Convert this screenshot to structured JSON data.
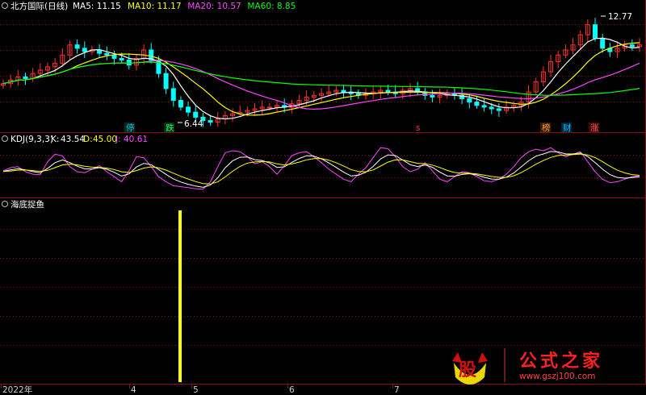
{
  "main_panel": {
    "title": "北方国际(日线)",
    "ma": [
      {
        "label": "MA5:",
        "value": "11.15",
        "color": "#ffffff"
      },
      {
        "label": "MA10:",
        "value": "11.17",
        "color": "#ffff00"
      },
      {
        "label": "MA20:",
        "value": "10.57",
        "color": "#ff44ff"
      },
      {
        "label": "MA60:",
        "value": "8.85",
        "color": "#00ff00"
      }
    ],
    "high_label": "12.77",
    "low_label": "6.44",
    "event_markers": [
      {
        "text": "停",
        "color": "#00c8c8",
        "bg": "#0a2a2a"
      },
      {
        "text": "跌",
        "color": "#00ff66",
        "bg": "#0a2a12"
      },
      {
        "text": "s",
        "color": "#ff3030",
        "bg": ""
      },
      {
        "text": "榜",
        "color": "#ff9933",
        "bg": "#3a2000"
      },
      {
        "text": "财",
        "color": "#00c8ff",
        "bg": "#00203a"
      },
      {
        "text": "涨",
        "color": "#ff5555",
        "bg": "#3a0a0a"
      }
    ]
  },
  "kdj_panel": {
    "title": "KDJ(9,3,3)",
    "k_label": "K:",
    "k_value": "43.54",
    "d_label": "D:",
    "d_value": "45.00",
    "j_label": "J:",
    "j_value": "40.61"
  },
  "signal_panel": {
    "title": "海底捉鱼"
  },
  "x_axis": {
    "labels": [
      "2022年",
      "4",
      "5",
      "6",
      "7"
    ]
  },
  "watermark": {
    "logo_char": "股",
    "brand": "公式之家",
    "url": "www.gszj100.com"
  },
  "colors": {
    "up_candle": "#ff3232",
    "down_candle": "#00ffff",
    "ma5": "#ffffff",
    "ma10": "#ffff00",
    "ma20": "#ff44ff",
    "ma60": "#00ff00",
    "kdj_k": "#ffffff",
    "kdj_d": "#ffff00",
    "kdj_j": "#ff44ff",
    "signal_bar": "#ffff00",
    "grid": "#8b1010"
  },
  "chart_data": [
    {
      "type": "candlestick",
      "title": "北方国际(日线)",
      "high_marker": 12.77,
      "low_marker": 6.44,
      "series": [
        {
          "name": "MA5",
          "last": 11.15
        },
        {
          "name": "MA10",
          "last": 11.17
        },
        {
          "name": "MA20",
          "last": 10.57
        },
        {
          "name": "MA60",
          "last": 8.85
        }
      ],
      "closes": [
        8.9,
        9.1,
        9.3,
        9.2,
        9.5,
        9.7,
        9.9,
        10.1,
        10.6,
        11.2,
        11.0,
        10.8,
        10.9,
        10.7,
        10.6,
        10.4,
        10.3,
        10.0,
        10.4,
        10.9,
        10.3,
        9.5,
        8.6,
        7.9,
        7.5,
        7.2,
        6.9,
        6.7,
        6.6,
        6.8,
        7.0,
        7.1,
        7.2,
        7.3,
        7.4,
        7.5,
        7.5,
        7.6,
        7.5,
        7.7,
        7.9,
        8.1,
        8.2,
        8.3,
        8.4,
        8.5,
        8.4,
        8.3,
        8.2,
        8.3,
        8.4,
        8.5,
        8.4,
        8.3,
        8.5,
        8.6,
        8.4,
        8.2,
        8.1,
        8.2,
        8.3,
        8.2,
        8.0,
        7.8,
        7.6,
        7.5,
        7.4,
        7.3,
        7.5,
        7.6,
        7.8,
        8.4,
        9.0,
        9.6,
        10.2,
        10.6,
        10.9,
        11.2,
        11.8,
        12.4,
        11.6,
        11.0,
        10.8,
        11.0,
        11.2,
        11.1,
        11.2
      ]
    },
    {
      "type": "line",
      "title": "KDJ(9,3,3)",
      "series": [
        {
          "name": "K",
          "last": 43.54
        },
        {
          "name": "D",
          "last": 45.0
        },
        {
          "name": "J",
          "last": 40.61
        }
      ],
      "j_values": [
        52,
        58,
        60,
        50,
        45,
        44,
        70,
        85,
        82,
        60,
        50,
        48,
        55,
        62,
        50,
        40,
        30,
        52,
        80,
        78,
        60,
        40,
        30,
        22,
        20,
        18,
        16,
        15,
        30,
        60,
        88,
        92,
        90,
        80,
        66,
        70,
        60,
        45,
        62,
        82,
        88,
        90,
        80,
        68,
        55,
        45,
        35,
        30,
        45,
        58,
        78,
        98,
        96,
        80,
        60,
        50,
        55,
        68,
        52,
        35,
        30,
        40,
        50,
        48,
        40,
        32,
        30,
        35,
        45,
        60,
        78,
        90,
        95,
        92,
        98,
        88,
        80,
        85,
        90,
        70,
        50,
        35,
        28,
        30,
        35,
        40,
        42
      ]
    },
    {
      "type": "bar",
      "title": "海底捉鱼",
      "series": [
        {
          "name": "signal",
          "values": [
            1
          ],
          "occurs_near": "4-5 boundary (late April 2022)"
        }
      ]
    }
  ]
}
